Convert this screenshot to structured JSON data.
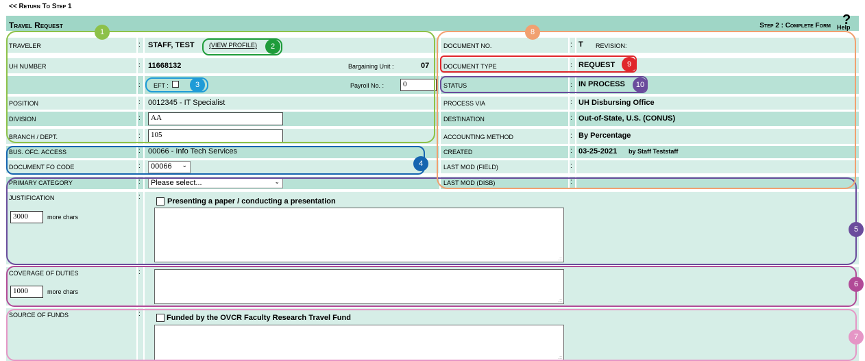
{
  "nav": {
    "return_link": "<< Return To Step 1"
  },
  "header": {
    "title": "Travel Request",
    "step": "Step 2 : Complete Form",
    "help_q": "?",
    "help_lp": "Help"
  },
  "left": {
    "traveler": {
      "label": "Traveler",
      "value": "STAFF, TEST",
      "link": "(VIEW PROFILE)"
    },
    "uh_number": {
      "label": "UH Number",
      "value": "11668132"
    },
    "bargaining": {
      "label": "Bargaining Unit :",
      "value": "07"
    },
    "eft": {
      "label": "EFT :"
    },
    "payroll": {
      "label": "Payroll No. :",
      "value": "0"
    },
    "position": {
      "label": "Position",
      "value": "0012345 - IT Specialist"
    },
    "division": {
      "label": "Division",
      "value": "AA"
    },
    "branch": {
      "label": "Branch / Dept.",
      "value": "105"
    },
    "bus_ofc": {
      "label": "Bus. Ofc. Access",
      "value": "00066 - Info Tech Services"
    },
    "fo_code": {
      "label": "Document FO Code",
      "value": "00066"
    },
    "primary_category": {
      "label": "Primary Category",
      "value": "Please select..."
    }
  },
  "right": {
    "doc_no": {
      "label": "Document No.",
      "value": "T",
      "revision": "REVISION:"
    },
    "doc_type": {
      "label": "Document Type",
      "value": "REQUEST"
    },
    "status": {
      "label": "Status",
      "value": "IN PROCESS"
    },
    "process_via": {
      "label": "Process Via",
      "value": "UH Disbursing Office"
    },
    "destination": {
      "label": "Destination",
      "value": "Out-of-State, U.S. (CONUS)"
    },
    "accounting": {
      "label": "Accounting Method",
      "value": "By Percentage"
    },
    "created": {
      "label": "Created",
      "date": "03-25-2021",
      "by": "by Staff Teststaff"
    },
    "last_mod_field": {
      "label": "Last Mod (Field)"
    },
    "last_mod_disb": {
      "label": "Last Mod (Disb)"
    }
  },
  "justification": {
    "label": "Justification",
    "checkbox_label": "Presenting a paper / conducting a presentation",
    "count": "3000",
    "more": "more chars"
  },
  "coverage": {
    "label": "Coverage of Duties",
    "count": "1000",
    "more": "more chars"
  },
  "funds": {
    "label": "Source of Funds",
    "checkbox_label": "Funded by the OVCR Faculty Research Travel Fund"
  },
  "colon": ":",
  "annotations": [
    "1",
    "2",
    "3",
    "4",
    "5",
    "6",
    "7",
    "8",
    "9",
    "10"
  ],
  "colors": {
    "header": "#9fd6c6",
    "light_row": "#d6eee7",
    "mid_row": "#b8e2d6",
    "ann_green": "#8dc149",
    "ann_darkgreen": "#1e9c3a",
    "ann_cyan": "#1e9bd7",
    "ann_blue": "#1565b0",
    "ann_purple": "#6a4c9c",
    "ann_magenta": "#b14a97",
    "ann_pink": "#e596c6",
    "ann_orange": "#f1a070",
    "ann_red": "#e0262b"
  }
}
